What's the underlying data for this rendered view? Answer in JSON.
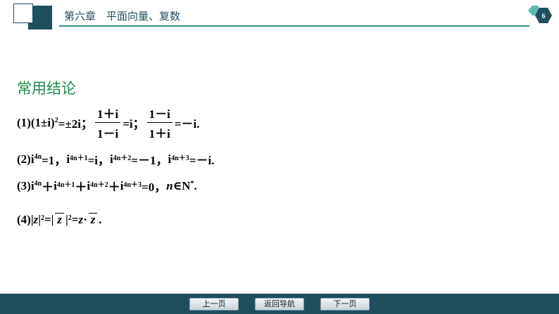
{
  "header": {
    "title": "第六章　平面向量、复数",
    "page_number": "6",
    "colors": {
      "primary": "#1f4e5f",
      "rule": "#3a8f8f",
      "badge_fill": "#1f4e5f",
      "badge_accent": "#5fb7b0"
    }
  },
  "content": {
    "heading": "常用结论",
    "heading_color": "#1e8a4a",
    "f1": {
      "label": "(1)",
      "lhs": "(1±i)",
      "exp": "2",
      "rhs": "=±2i；",
      "frac1_num": "1＋i",
      "frac1_den": "1－i",
      "after1": "=i；",
      "frac2_num": "1－i",
      "frac2_den": "1＋i",
      "after2": "=－i."
    },
    "f2": {
      "label": "(2)",
      "t1": "i",
      "e1": "4n",
      "r1": "=1，",
      "t2": "i",
      "e2": "4n＋1",
      "r2": "=i，",
      "t3": "i",
      "e3": "4n＋2",
      "r3": "=－1，",
      "t4": "i",
      "e4": "4n＋3",
      "r4": "=－i."
    },
    "f3": {
      "label": "(3)",
      "t1": "i",
      "e1": "4n",
      "p1": "＋",
      "t2": "i",
      "e2": "4n＋1",
      "p2": "＋",
      "t3": "i",
      "e3": "4n＋2",
      "p3": "＋",
      "t4": "i",
      "e4": "4n＋3",
      "eq": "=0，",
      "n": "n",
      "in": "∈N",
      "star": "*",
      "end": "."
    },
    "f4": {
      "label": "(4)",
      "a": "|",
      "z": "z",
      "b": "|",
      "e1": "2",
      "eq1": "=|",
      "zbar": "z",
      "c": "|",
      "e2": "2",
      "eq2": "=",
      "z2": "z",
      "dot": "·",
      "zbar2": "z",
      "end": "."
    }
  },
  "footer": {
    "prev": "上一页",
    "home": "返回导航",
    "next": "下一页",
    "bar_color": "#1f4e5f"
  }
}
